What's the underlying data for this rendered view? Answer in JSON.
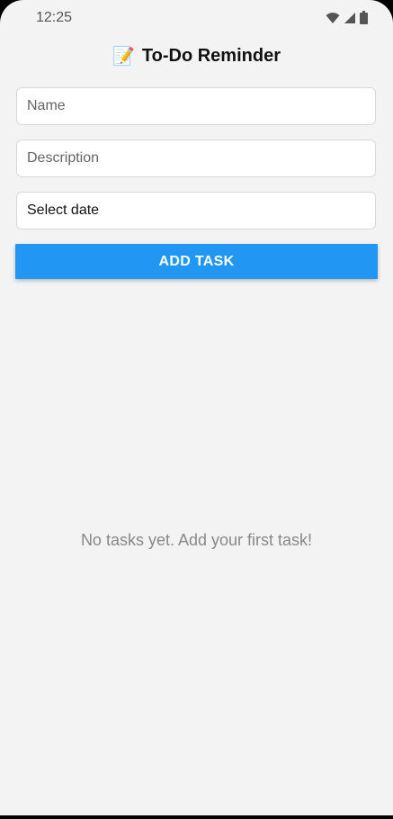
{
  "status_bar": {
    "time": "12:25",
    "icons": [
      "wifi-icon",
      "cell-signal-icon",
      "battery-icon"
    ]
  },
  "header": {
    "emoji": "📝",
    "title": "To-Do Reminder"
  },
  "form": {
    "name_placeholder": "Name",
    "description_placeholder": "Description",
    "date_label": "Select date",
    "add_button_label": "ADD TASK"
  },
  "tasks": {
    "empty_message": "No tasks yet. Add your first task!"
  },
  "colors": {
    "accent": "#2196f3",
    "background": "#f3f3f3"
  }
}
